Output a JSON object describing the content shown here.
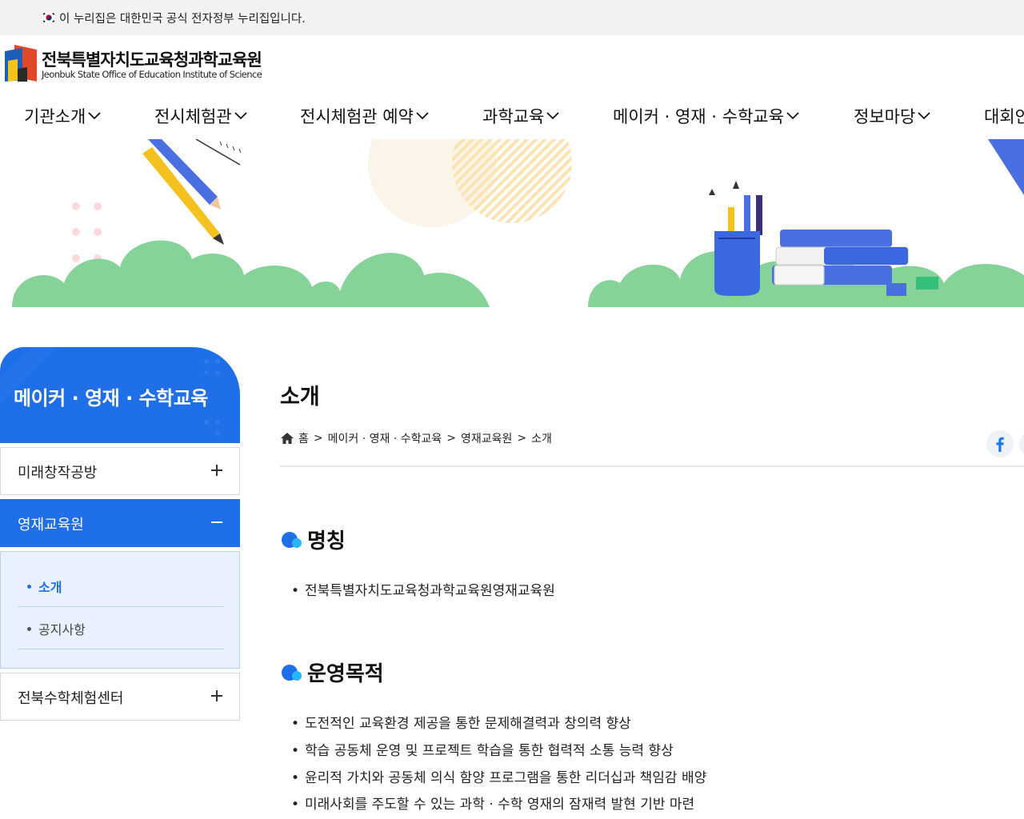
{
  "gov_banner": {
    "text": "이 누리집은 대한민국 공식 전자정부 누리집입니다."
  },
  "logo": {
    "name_ko": "전북특별자치도교육청과학교육원",
    "name_en": "Jeonbuk State Office of Education Institute of Science"
  },
  "gnb": [
    {
      "label": "기관소개"
    },
    {
      "label": "전시체험관"
    },
    {
      "label": "전시체험관 예약"
    },
    {
      "label": "과학교육"
    },
    {
      "label": "메이커 · 영재 · 수학교육"
    },
    {
      "label": "정보마당"
    },
    {
      "label": "대회안내"
    }
  ],
  "sidebar": {
    "title": "메이커 · 영재 · 수학교육",
    "items": [
      {
        "label": "미래창작공방",
        "state": "collapsed"
      },
      {
        "label": "영재교육원",
        "state": "expanded"
      },
      {
        "label": "전북수학체험센터",
        "state": "collapsed"
      }
    ],
    "sub_items": [
      {
        "label": "소개",
        "current": true
      },
      {
        "label": "공지사항",
        "current": false
      }
    ]
  },
  "content": {
    "title": "소개",
    "breadcrumb": [
      "홈",
      "메이커 · 영재 · 수학교육",
      "영재교육원",
      "소개"
    ],
    "breadcrumb_sep": ">",
    "sections": [
      {
        "heading": "명칭",
        "bullets": [
          "전북특별자치도교육청과학교육원영재교육원"
        ]
      },
      {
        "heading": "운영목적",
        "bullets": [
          "도전적인 교육환경 제공을 통한 문제해결력과 창의력 향상",
          "학습 공동체 운영 및 프로젝트 학습을 통한 협력적 소통 능력 향상",
          "윤리적 가치와 공동체 의식 함양 프로그램을 통한 리더십과 책임감 배양",
          "미래사회를 주도할 수 있는 과학 · 수학 영재의 잠재력 발현 기반 마련"
        ]
      }
    ]
  },
  "icons": {
    "flag": "korea-flag-icon",
    "chevron": "chevron-down-icon",
    "home": "home-icon",
    "facebook": "facebook-icon",
    "plus": "plus-icon",
    "minus": "minus-icon"
  },
  "colors": {
    "primary": "#1f6fe8",
    "hero_green": "#86d39a",
    "sub_bg": "#e8f1fd"
  }
}
